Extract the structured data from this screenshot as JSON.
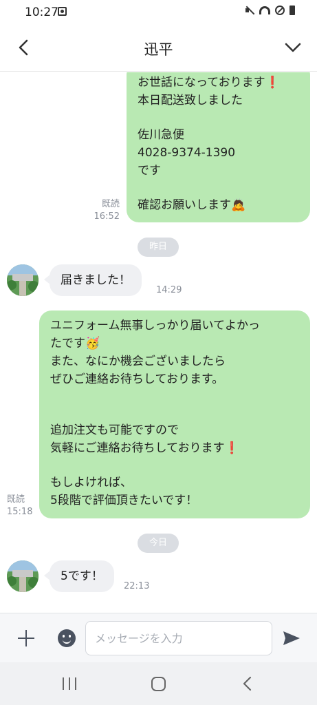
{
  "status_bar": {
    "time": "10:27",
    "icons": [
      "notification-icon",
      "mute-icon",
      "wifi-icon",
      "do-not-disturb-icon",
      "battery-icon"
    ]
  },
  "header": {
    "title": "迅平",
    "back_icon": "chevron-left-icon",
    "menu_icon": "chevron-down-icon"
  },
  "messages": {
    "msg1": {
      "direction": "outgoing",
      "lines": [
        "お世話になっております❗",
        "本日配送致しました",
        "",
        "佐川急便",
        "4028-9374-1390",
        "です",
        "",
        "確認お願いします🙇"
      ],
      "read_label": "既読",
      "time": "16:52"
    },
    "date1": "昨日",
    "msg2": {
      "direction": "incoming",
      "text": "届きました！",
      "time": "14:29"
    },
    "msg3": {
      "direction": "outgoing",
      "lines": [
        "ユニフォーム無事しっかり届いてよかっ",
        "たです🥳",
        "また、なにか機会ございましたら",
        "ぜひご連絡お待ちしております。",
        "",
        "",
        "追加注文も可能ですので",
        "気軽にご連絡お待ちしております❗",
        "",
        "もしよければ、",
        "5段階で評価頂きたいです！"
      ],
      "read_label": "既読",
      "time": "15:18"
    },
    "date2": "今日",
    "msg4": {
      "direction": "incoming",
      "text": "5です！",
      "time": "22:13"
    }
  },
  "input_bar": {
    "placeholder": "メッセージを入力",
    "value": ""
  },
  "colors": {
    "outgoing_bubble": "#b9e9b3",
    "incoming_bubble": "#eff0f3",
    "date_chip": "#dadde2",
    "meta_text": "#8a8f99"
  }
}
